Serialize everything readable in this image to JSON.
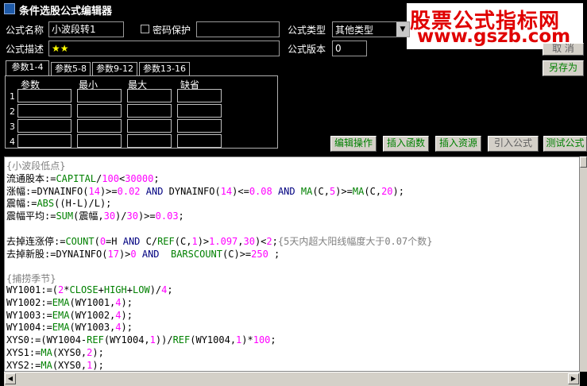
{
  "window": {
    "title": "条件选股公式编辑器"
  },
  "form": {
    "name_label": "公式名称",
    "name_value": "小波段转1",
    "password_label": "密码保护",
    "desc_label": "公式描述",
    "desc_value": "★★",
    "type_label": "公式类型",
    "type_value": "其他类型",
    "version_label": "公式版本",
    "version_value": "0"
  },
  "right_buttons": {
    "cancel": "取 消",
    "save_as": "另存为"
  },
  "tabs": [
    "参数1-4",
    "参数5-8",
    "参数9-12",
    "参数13-16"
  ],
  "params": {
    "headers": [
      "参数",
      "最小",
      "最大",
      "缺省"
    ],
    "rows": [
      "1",
      "2",
      "3",
      "4"
    ]
  },
  "action_buttons": [
    "编辑操作",
    "插入函数",
    "插入资源",
    "引入公式",
    "测试公式"
  ],
  "watermark": {
    "line1": "股票公式指标网",
    "line2": "www.gszb.com"
  },
  "code": [
    {
      "segs": [
        [
          "{小波段低点}",
          "#808080"
        ]
      ]
    },
    {
      "segs": [
        [
          "流通股本:=",
          "#000"
        ],
        [
          "CAPITAL",
          "#008000"
        ],
        [
          "/",
          "#000"
        ],
        [
          "100",
          "#ff00ff"
        ],
        [
          "<",
          "#000"
        ],
        [
          "30000",
          "#ff00ff"
        ],
        [
          ";",
          "#000"
        ]
      ]
    },
    {
      "segs": [
        [
          "涨幅:=",
          "#000"
        ],
        [
          "DYNAINFO",
          "#000"
        ],
        [
          "(",
          "#000"
        ],
        [
          "14",
          "#ff00ff"
        ],
        [
          ")>=",
          "#000"
        ],
        [
          "0.02",
          "#ff00ff"
        ],
        [
          " AND ",
          "#000080"
        ],
        [
          "DYNAINFO",
          "#000"
        ],
        [
          "(",
          "#000"
        ],
        [
          "14",
          "#ff00ff"
        ],
        [
          ")<=",
          "#000"
        ],
        [
          "0.08",
          "#ff00ff"
        ],
        [
          " AND ",
          "#000080"
        ],
        [
          "MA",
          "#008000"
        ],
        [
          "(C,",
          "#000"
        ],
        [
          "5",
          "#ff00ff"
        ],
        [
          ")>=",
          "#000"
        ],
        [
          "MA",
          "#008000"
        ],
        [
          "(C,",
          "#000"
        ],
        [
          "20",
          "#ff00ff"
        ],
        [
          ");",
          "#000"
        ]
      ]
    },
    {
      "segs": [
        [
          "震幅:=",
          "#000"
        ],
        [
          "ABS",
          "#008000"
        ],
        [
          "((H-L)/L);",
          "#000"
        ]
      ]
    },
    {
      "segs": [
        [
          "震幅平均:=",
          "#000"
        ],
        [
          "SUM",
          "#008000"
        ],
        [
          "(震幅,",
          "#000"
        ],
        [
          "30",
          "#ff00ff"
        ],
        [
          ")/",
          "#000"
        ],
        [
          "30",
          "#ff00ff"
        ],
        [
          ")>=",
          "#000"
        ],
        [
          "0.03",
          "#ff00ff"
        ],
        [
          ";",
          "#000"
        ]
      ]
    },
    {
      "segs": []
    },
    {
      "segs": [
        [
          "去掉连涨停:=",
          "#000"
        ],
        [
          "COUNT",
          "#008000"
        ],
        [
          "(",
          "#000"
        ],
        [
          "0",
          "#ff00ff"
        ],
        [
          "=H",
          "#000"
        ],
        [
          " AND ",
          "#000080"
        ],
        [
          "C/",
          "#000"
        ],
        [
          "REF",
          "#008000"
        ],
        [
          "(C,",
          "#000"
        ],
        [
          "1",
          "#ff00ff"
        ],
        [
          ")>",
          "#000"
        ],
        [
          "1.097",
          "#ff00ff"
        ],
        [
          ",",
          "#000"
        ],
        [
          "30",
          "#ff00ff"
        ],
        [
          ")<",
          "#000"
        ],
        [
          "2",
          "#ff00ff"
        ],
        [
          ";",
          "#000"
        ],
        [
          "{5天内超大阳线幅度大于0.07个数}",
          "#808080"
        ]
      ]
    },
    {
      "segs": [
        [
          "去掉新股:=",
          "#000"
        ],
        [
          "DYNAINFO",
          "#000"
        ],
        [
          "(",
          "#000"
        ],
        [
          "17",
          "#ff00ff"
        ],
        [
          ")>",
          "#000"
        ],
        [
          "0",
          "#ff00ff"
        ],
        [
          " AND  ",
          "#000080"
        ],
        [
          "BARSCOUNT",
          "#008000"
        ],
        [
          "(C)>=",
          "#000"
        ],
        [
          "250",
          "#ff00ff"
        ],
        [
          " ;",
          "#000"
        ]
      ]
    },
    {
      "segs": []
    },
    {
      "segs": [
        [
          "{捕捞季节}",
          "#808080"
        ]
      ]
    },
    {
      "segs": [
        [
          "WY1001:=(",
          "#000"
        ],
        [
          "2",
          "#ff00ff"
        ],
        [
          "*",
          "#000"
        ],
        [
          "CLOSE",
          "#008000"
        ],
        [
          "+",
          "#000"
        ],
        [
          "HIGH",
          "#008000"
        ],
        [
          "+",
          "#000"
        ],
        [
          "LOW",
          "#008000"
        ],
        [
          ")/",
          "#000"
        ],
        [
          "4",
          "#ff00ff"
        ],
        [
          ";",
          "#000"
        ]
      ]
    },
    {
      "segs": [
        [
          "WY1002:=",
          "#000"
        ],
        [
          "EMA",
          "#008000"
        ],
        [
          "(WY1001,",
          "#000"
        ],
        [
          "4",
          "#ff00ff"
        ],
        [
          ");",
          "#000"
        ]
      ]
    },
    {
      "segs": [
        [
          "WY1003:=",
          "#000"
        ],
        [
          "EMA",
          "#008000"
        ],
        [
          "(WY1002,",
          "#000"
        ],
        [
          "4",
          "#ff00ff"
        ],
        [
          ");",
          "#000"
        ]
      ]
    },
    {
      "segs": [
        [
          "WY1004:=",
          "#000"
        ],
        [
          "EMA",
          "#008000"
        ],
        [
          "(WY1003,",
          "#000"
        ],
        [
          "4",
          "#ff00ff"
        ],
        [
          ");",
          "#000"
        ]
      ]
    },
    {
      "segs": [
        [
          "XYS0:=(WY1004-",
          "#000"
        ],
        [
          "REF",
          "#008000"
        ],
        [
          "(WY1004,",
          "#000"
        ],
        [
          "1",
          "#ff00ff"
        ],
        [
          "))/",
          "#000"
        ],
        [
          "REF",
          "#008000"
        ],
        [
          "(WY1004,",
          "#000"
        ],
        [
          "1",
          "#ff00ff"
        ],
        [
          ")*",
          "#000"
        ],
        [
          "100",
          "#ff00ff"
        ],
        [
          ";",
          "#000"
        ]
      ]
    },
    {
      "segs": [
        [
          "XYS1:=",
          "#000"
        ],
        [
          "MA",
          "#008000"
        ],
        [
          "(XYS0,",
          "#000"
        ],
        [
          "2",
          "#ff00ff"
        ],
        [
          ");",
          "#000"
        ]
      ]
    },
    {
      "segs": [
        [
          "XYS2:=",
          "#000"
        ],
        [
          "MA",
          "#008000"
        ],
        [
          "(XYS0,",
          "#000"
        ],
        [
          "1",
          "#ff00ff"
        ],
        [
          ");",
          "#000"
        ]
      ]
    }
  ]
}
